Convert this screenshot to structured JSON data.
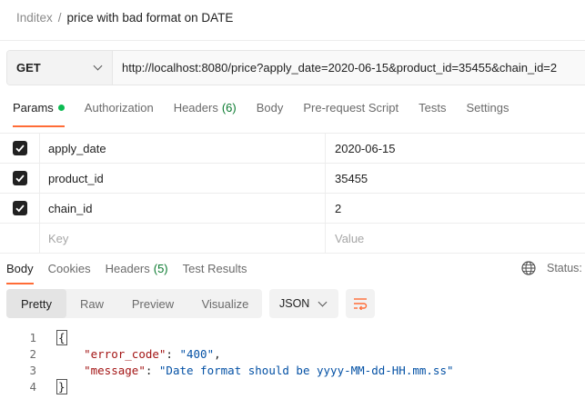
{
  "breadcrumb": {
    "parent": "Inditex",
    "separator": "/",
    "current": "price with bad format on DATE"
  },
  "request": {
    "method": "GET",
    "url": "http://localhost:8080/price?apply_date=2020-06-15&product_id=35455&chain_id=2"
  },
  "request_tabs": [
    {
      "label": "Params",
      "active": true,
      "indicator": "green-dot"
    },
    {
      "label": "Authorization"
    },
    {
      "label": "Headers",
      "count": "(6)"
    },
    {
      "label": "Body"
    },
    {
      "label": "Pre-request Script"
    },
    {
      "label": "Tests"
    },
    {
      "label": "Settings"
    }
  ],
  "params": [
    {
      "key": "apply_date",
      "value": "2020-06-15",
      "checked": true
    },
    {
      "key": "product_id",
      "value": "35455",
      "checked": true
    },
    {
      "key": "chain_id",
      "value": "2",
      "checked": true
    }
  ],
  "params_placeholder": {
    "key": "Key",
    "value": "Value"
  },
  "response_tabs": [
    {
      "label": "Body",
      "active": true
    },
    {
      "label": "Cookies"
    },
    {
      "label": "Headers",
      "count": "(5)"
    },
    {
      "label": "Test Results"
    }
  ],
  "status_label": "Status:",
  "view_tabs": [
    "Pretty",
    "Raw",
    "Preview",
    "Visualize"
  ],
  "view_active": "Pretty",
  "language": "JSON",
  "code_lines": [
    {
      "num": "1",
      "text": "{"
    },
    {
      "num": "2",
      "key": "\"error_code\"",
      "sep": ": ",
      "value": "\"400\"",
      "tail": ","
    },
    {
      "num": "3",
      "key": "\"message\"",
      "sep": ": ",
      "value": "\"Date format should be yyyy-MM-dd-HH.mm.ss\"",
      "tail": ""
    },
    {
      "num": "4",
      "text": "}"
    }
  ],
  "colors": {
    "accent": "#ff6c37",
    "indicator_green": "#0cbb52",
    "count_green": "#0a7a2f",
    "json_key": "#a31515",
    "json_string": "#0451a5"
  }
}
